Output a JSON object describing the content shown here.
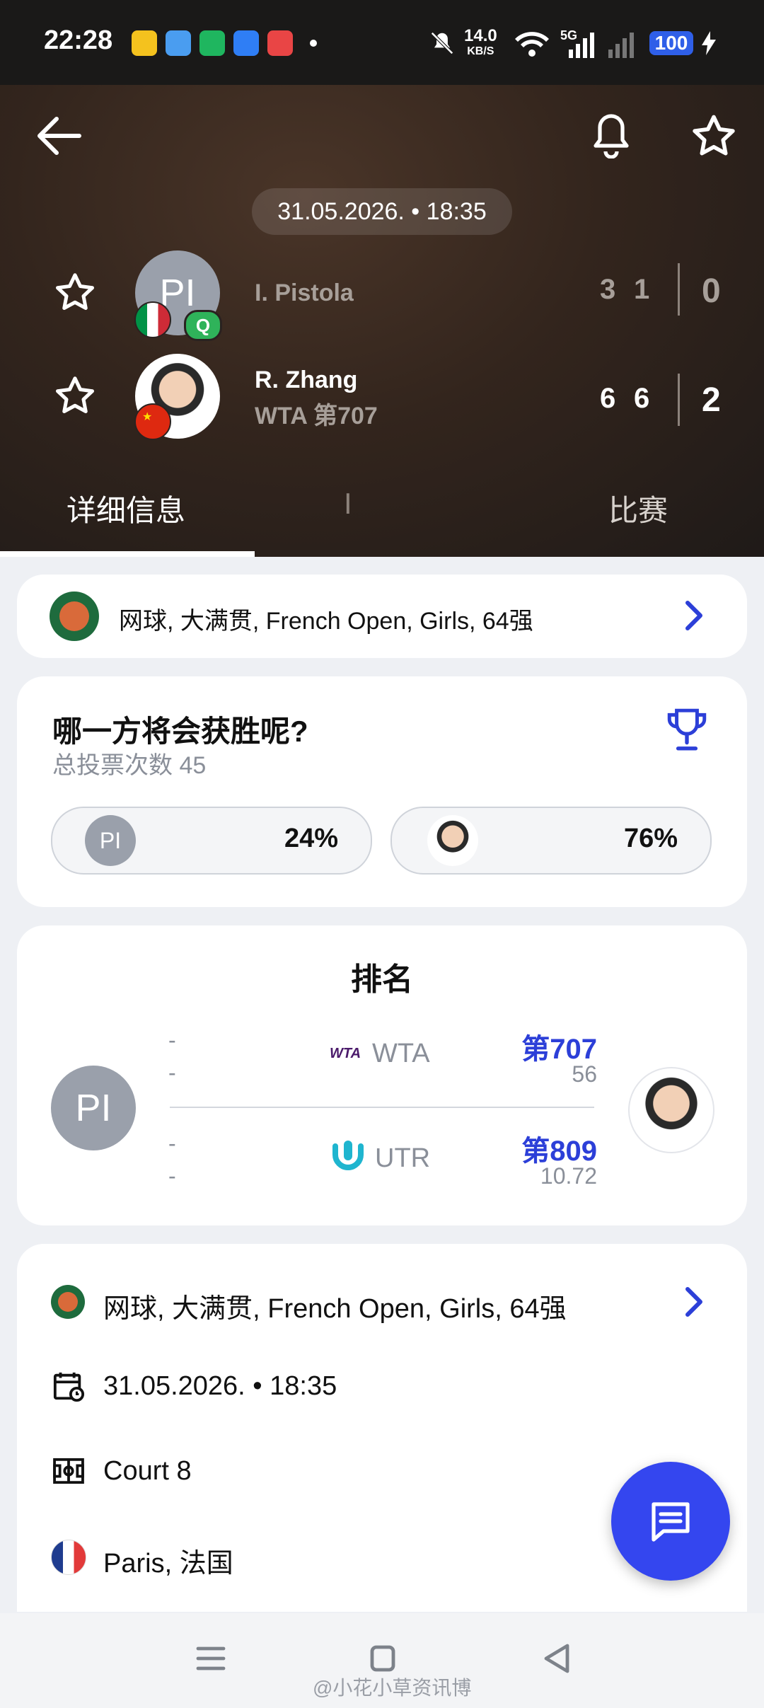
{
  "status_bar": {
    "time": "22:28",
    "net_speed_value": "14.0",
    "net_speed_unit": "KB/S",
    "signal_label": "5G",
    "battery": "100"
  },
  "header": {
    "date_chip": "31.05.2026. • 18:35",
    "player1": {
      "initials": "PI",
      "name": "I. Pistola",
      "badge": "Q",
      "set_scores": [
        "3",
        "1"
      ],
      "sets_won": "0"
    },
    "player2": {
      "name": "R. Zhang",
      "ranking": "WTA 第707",
      "set_scores": [
        "6",
        "6"
      ],
      "sets_won": "2"
    }
  },
  "tabs": [
    {
      "label": "详细信息",
      "active": true
    },
    {
      "label": "I",
      "active": false
    },
    {
      "label": "比赛",
      "active": false
    }
  ],
  "tournament_card": {
    "label": "网球, 大满贯, French Open, Girls, 64强"
  },
  "vote_card": {
    "title": "哪一方将会获胜呢?",
    "subtitle": "总投票次数 45",
    "player1_initials": "PI",
    "player1_pct": "24%",
    "player2_pct": "76%"
  },
  "ranking_card": {
    "title": "排名",
    "player1_initials": "PI",
    "rows": [
      {
        "org_logo": "WTA",
        "org": "WTA",
        "p1_rank": "-",
        "p1_points": "-",
        "p2_rank": "第707",
        "p2_points": "56"
      },
      {
        "org": "UTR",
        "p1_rank": "-",
        "p1_points": "-",
        "p2_rank": "第809",
        "p2_points": "10.72"
      }
    ]
  },
  "details_card": {
    "tournament": "网球, 大满贯, French Open, Girls, 64强",
    "datetime": "31.05.2026. • 18:35",
    "court": "Court 8",
    "location": "Paris, 法国"
  },
  "watermark": "@小花小草资讯博",
  "colors": {
    "accent": "#2c3fd8",
    "fab": "#3446ef",
    "header_bg": "#33251d"
  }
}
